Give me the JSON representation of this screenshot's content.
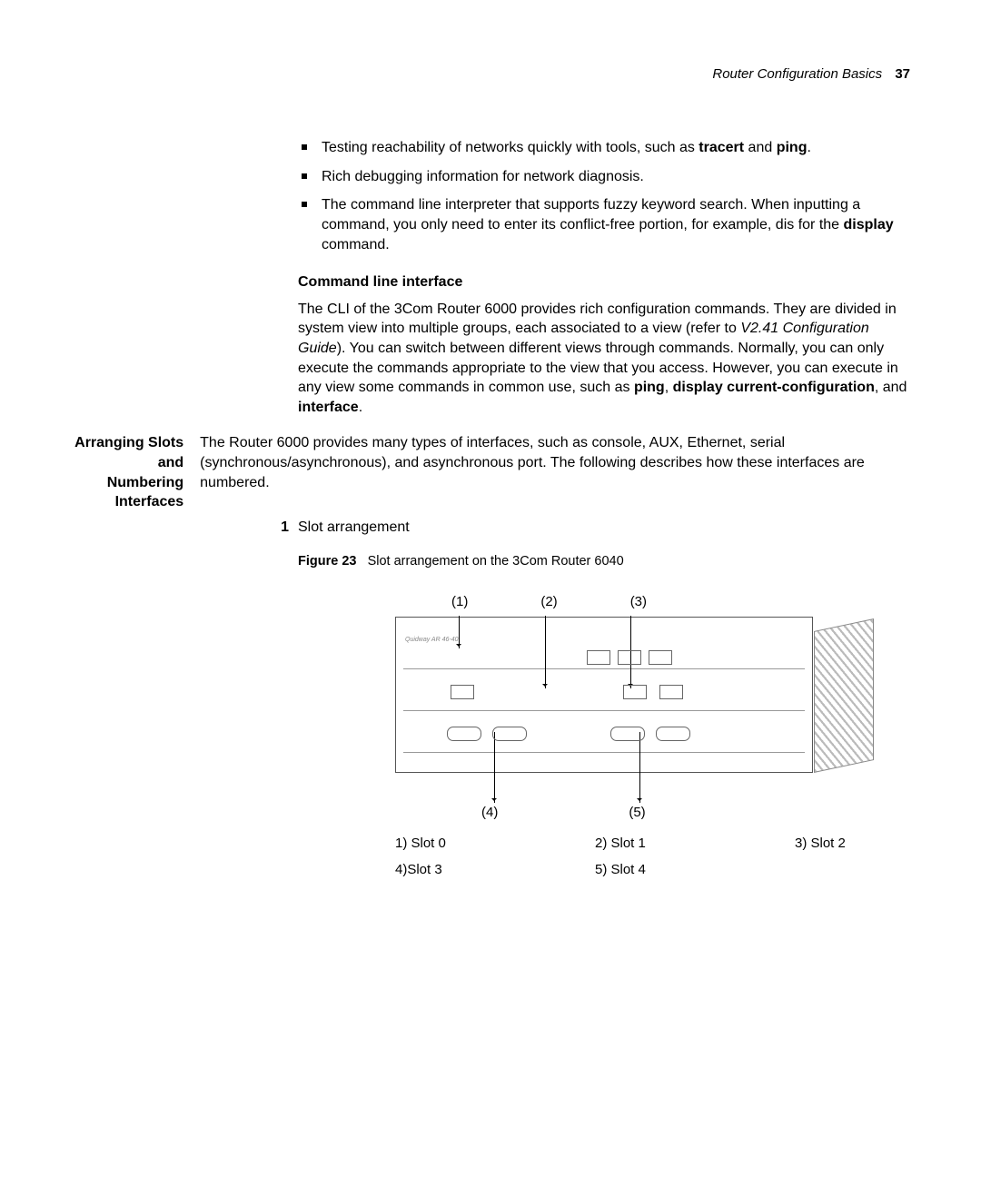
{
  "header": {
    "title": "Router Configuration Basics",
    "page": "37"
  },
  "bullets": {
    "b1a": "Testing reachability of networks quickly with tools, such as ",
    "b1b": "tracert",
    "b1c": " and ",
    "b1d": "ping",
    "b1e": ".",
    "b2": "Rich debugging information for network diagnosis.",
    "b3a": "The command line interpreter that supports fuzzy keyword search. When inputting a command, you only need to enter its conflict-free portion, for example, dis for the ",
    "b3b": "display",
    "b3c": " command."
  },
  "cli": {
    "heading": "Command line interface",
    "p1a": "The CLI of the 3Com Router 6000 provides rich configuration commands. They are divided in system view into multiple groups, each associated to a view (refer to ",
    "p1b": "V2.41 Configuration Guide",
    "p1c": "). You can switch between different views through commands. Normally, you can only execute the commands appropriate to the view that you access. However, you can execute in any view some commands in common use, such as ",
    "p1d": "ping",
    "p1e": ", ",
    "p1f": "display current-configuration",
    "p1g": ", and ",
    "p1h": "interface",
    "p1i": "."
  },
  "section": {
    "side1": "Arranging Slots and",
    "side2": "Numbering Interfaces",
    "intro": "The Router 6000 provides many types of interfaces, such as console, AUX, Ethernet, serial (synchronous/asynchronous), and asynchronous port. The following describes how these interfaces are numbered.",
    "numlabel": "1",
    "numtext": "Slot arrangement",
    "figlabel": "Figure 23",
    "figtext": "Slot arrangement on the 3Com Router 6040"
  },
  "callouts": {
    "c1": "(1)",
    "c2": "(2)",
    "c3": "(3)",
    "c4": "(4)",
    "c5": "(5)"
  },
  "legend": {
    "l1": "1) Slot 0",
    "l2": "2) Slot 1",
    "l3": "3) Slot 2",
    "l4": "4)Slot 3",
    "l5": "5) Slot 4"
  },
  "tiny": {
    "model": "Quidway AR 46-40"
  }
}
